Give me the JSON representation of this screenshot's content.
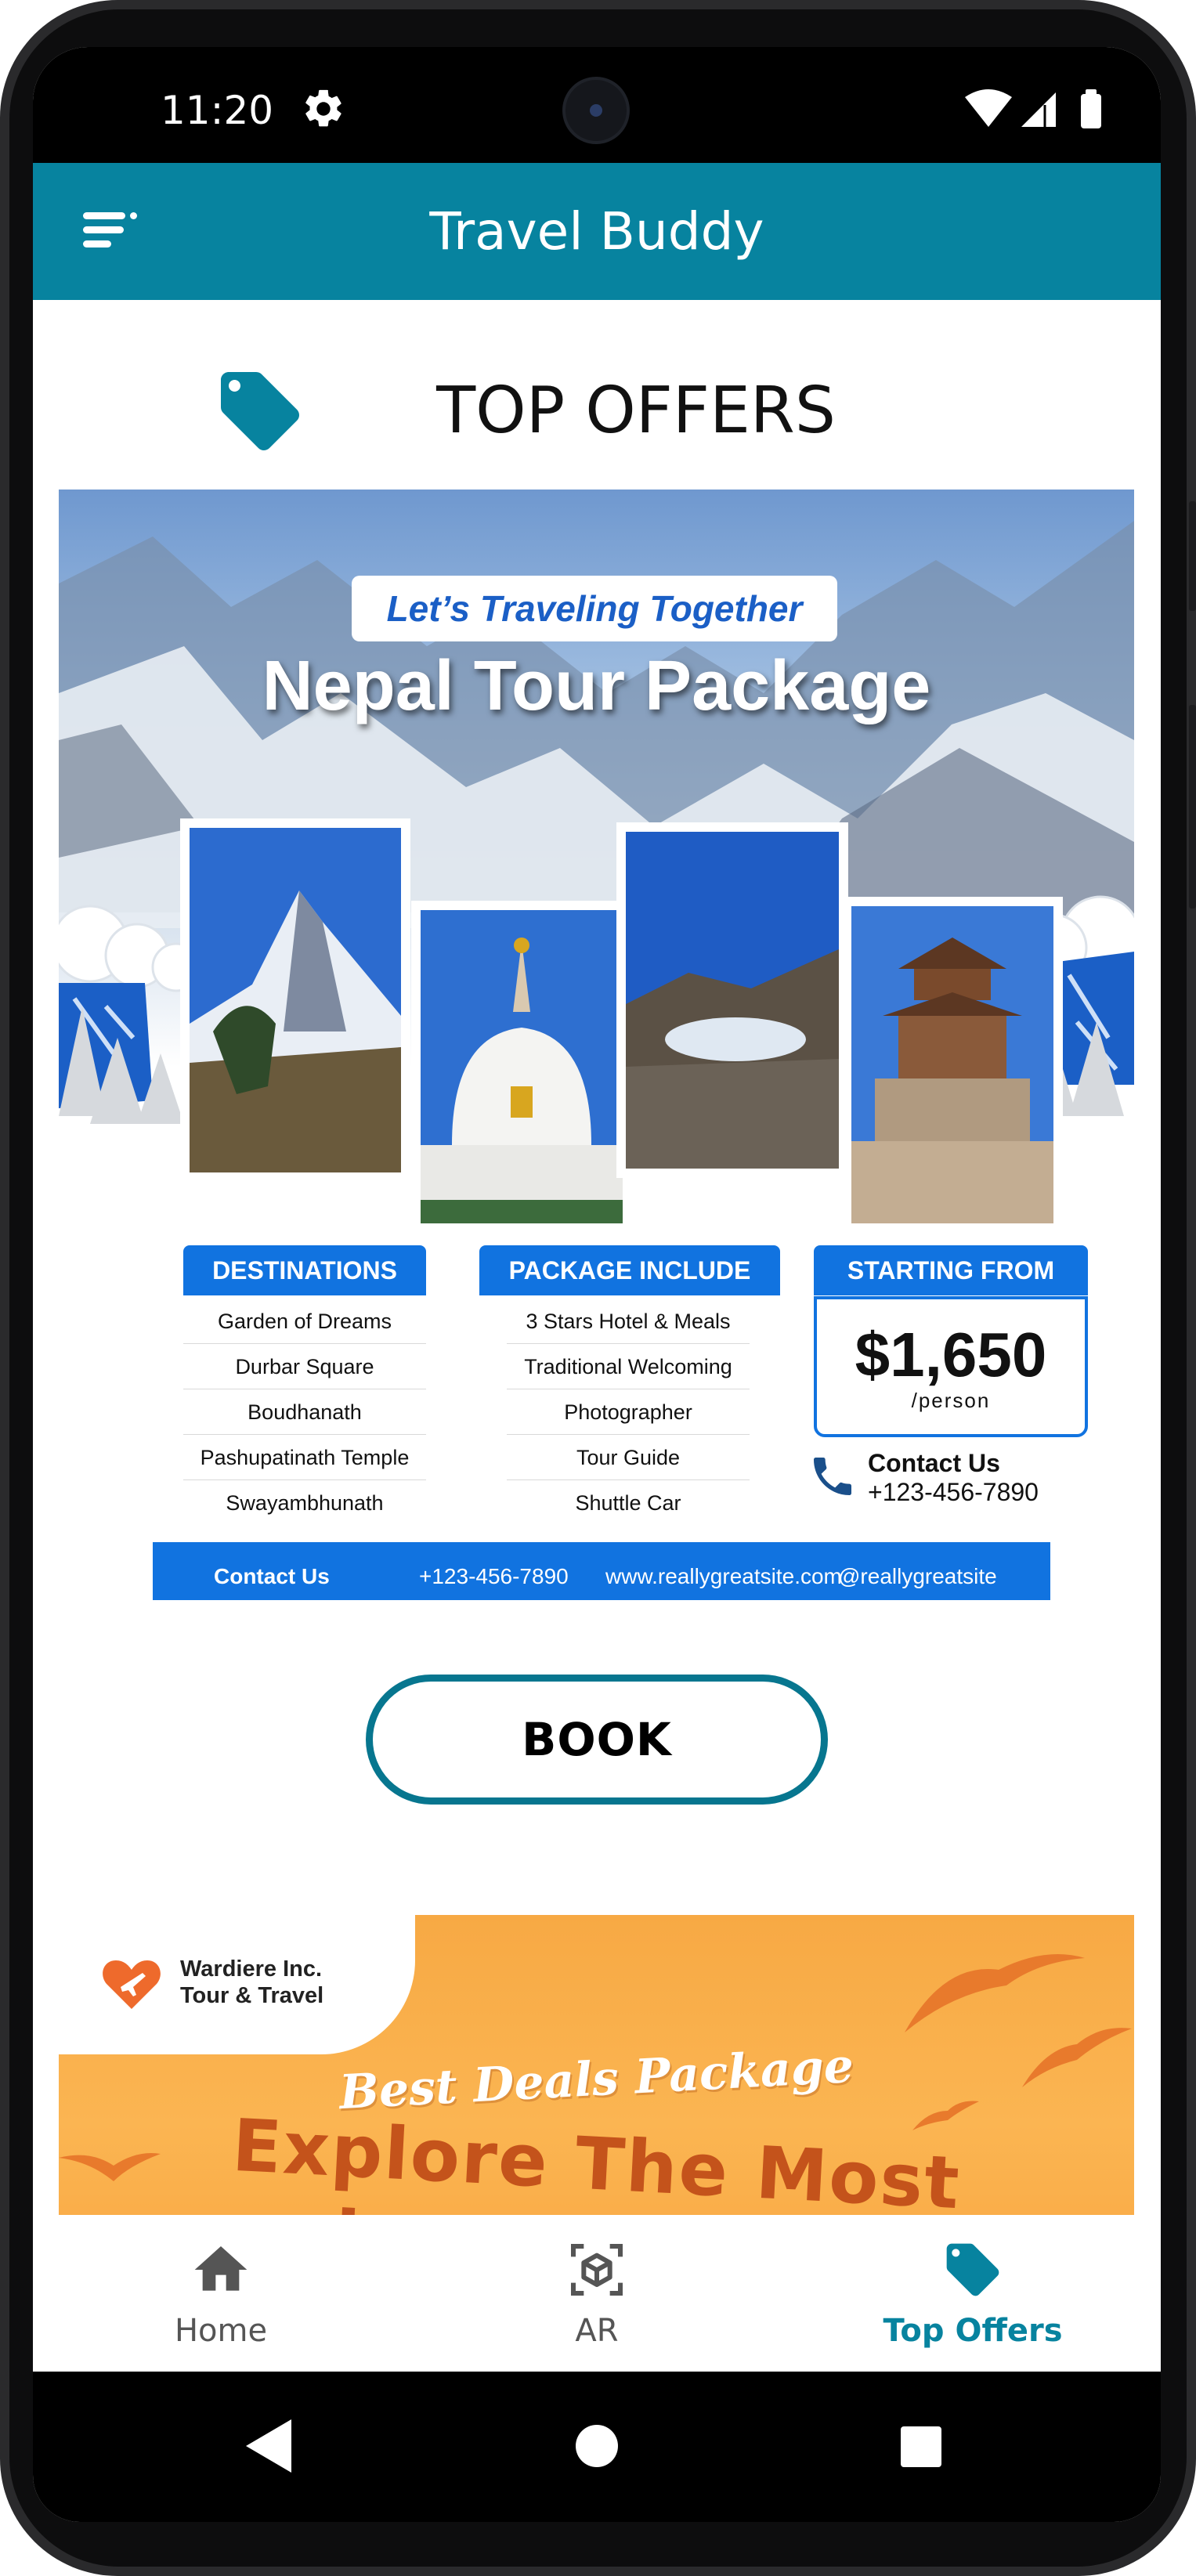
{
  "status_bar": {
    "time": "11:20"
  },
  "app_bar": {
    "title": "Travel Buddy"
  },
  "header": {
    "title": "TOP OFFERS"
  },
  "poster": {
    "tagline": "Let’s Traveling Together",
    "title": "Nepal Tour Package",
    "destinations": {
      "heading": "DESTINATIONS",
      "items": [
        "Garden of Dreams",
        "Durbar Square",
        "Boudhanath",
        "Pashupatinath Temple",
        "Swayambhunath"
      ]
    },
    "package_include": {
      "heading": "PACKAGE INCLUDE",
      "items": [
        "3 Stars Hotel & Meals",
        "Traditional Welcoming",
        "Photographer",
        "Tour Guide",
        "Shuttle Car"
      ]
    },
    "starting_from": {
      "heading": "STARTING FROM",
      "price": "$1,650",
      "unit": "/person"
    },
    "contact": {
      "title": "Contact Us",
      "phone": "+123-456-7890"
    },
    "footer": {
      "contact_label": "Contact Us",
      "phone": "+123-456-7890",
      "website": "www.reallygreatsite.com",
      "social": "@reallygreatsite"
    }
  },
  "book_button": {
    "label": "BOOK"
  },
  "banner2": {
    "company_line1": "Wardiere Inc.",
    "company_line2": "Tour & Travel",
    "tagline": "Best Deals Package",
    "headline_line1": "Explore The Most",
    "headline_line2": "...lar Destinati..."
  },
  "bottom_nav": {
    "items": [
      {
        "label": "Home",
        "icon": "home-icon",
        "active": false
      },
      {
        "label": "AR",
        "icon": "ar-cube-icon",
        "active": false
      },
      {
        "label": "Top Offers",
        "icon": "tag-icon",
        "active": true
      }
    ]
  },
  "colors": {
    "primary": "#07839f",
    "poster_blue": "#1173e0",
    "banner_orange": "#f7a944",
    "headline_orange": "#c4531b"
  }
}
